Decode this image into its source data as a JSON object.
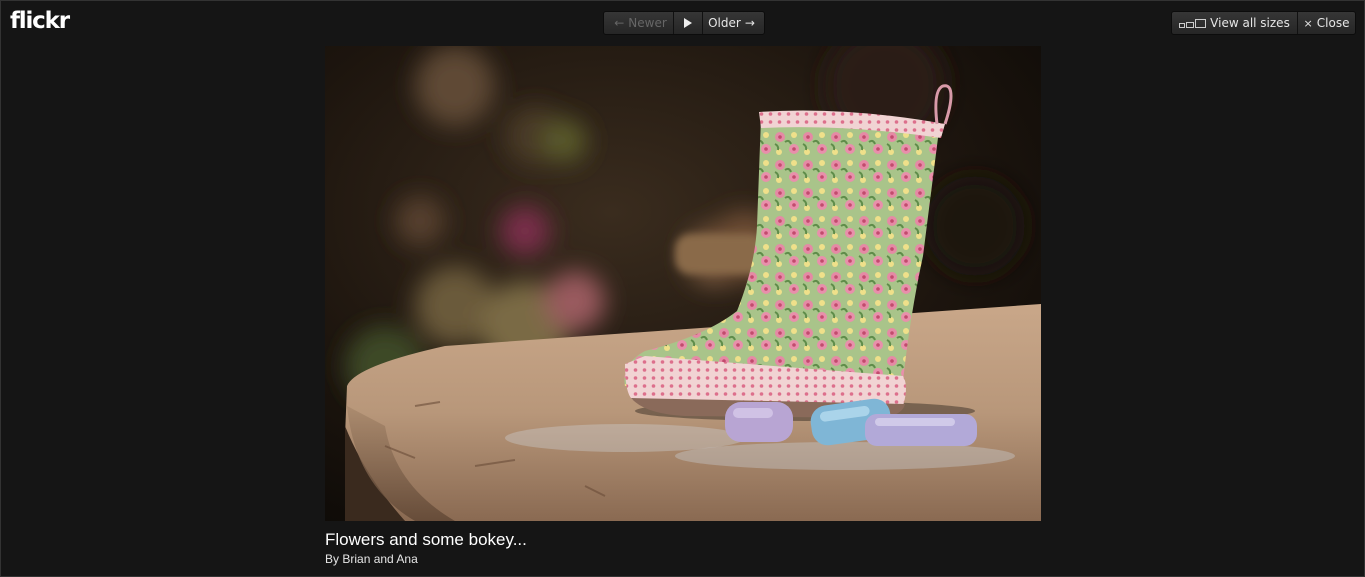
{
  "logo": {
    "text": "flickr",
    "mark": "r"
  },
  "nav": {
    "newer_label": "Newer",
    "older_label": "Older",
    "newer_arrow": "←",
    "older_arrow": "→",
    "play_icon": "play-icon"
  },
  "toolbar": {
    "view_sizes_label": "View all sizes",
    "close_label": "Close",
    "close_glyph": "×",
    "sizes_icon": "sizes-icon"
  },
  "photo": {
    "title": "Flowers and some bokey...",
    "by_prefix": "By",
    "author": "Brian and Ana"
  },
  "colors": {
    "background": "#151515",
    "button_bg": "#2e2e2e",
    "text": "#ffffff"
  }
}
